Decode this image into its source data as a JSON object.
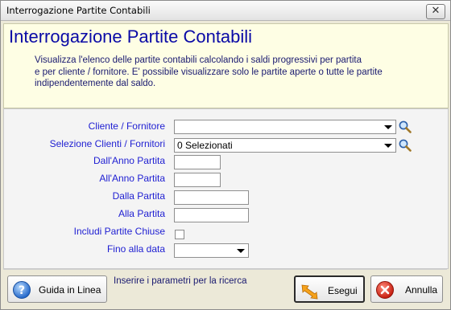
{
  "window": {
    "title": "Interrogazione Partite Contabili",
    "close_glyph": "✕"
  },
  "header": {
    "title": "Interrogazione Partite Contabili",
    "description": [
      "Visualizza l'elenco delle partite contabili calcolando i saldi progressivi per partita",
      "e per cliente / fornitore. E' possibile visualizzare solo le partite aperte o tutte le partite",
      "indipendentemente dal saldo."
    ]
  },
  "form": {
    "cliente_fornitore": {
      "label": "Cliente / Fornitore",
      "value": ""
    },
    "selezione_clienti": {
      "label": "Selezione Clienti / Fornitori",
      "value": "0 Selezionati"
    },
    "dall_anno": {
      "label": "Dall'Anno Partita",
      "value": ""
    },
    "all_anno": {
      "label": "All'Anno Partita",
      "value": ""
    },
    "dalla_partita": {
      "label": "Dalla Partita",
      "value": ""
    },
    "alla_partita": {
      "label": "Alla Partita",
      "value": ""
    },
    "includi_chiuse": {
      "label": "Includi Partite Chiuse",
      "checked": false
    },
    "fino_data": {
      "label": "Fino alla data",
      "value": ""
    }
  },
  "footer": {
    "help_label": "Guida in Linea",
    "status_text": "Inserire i parametri per la ricerca",
    "execute_label": "Esegui",
    "cancel_label": "Annulla"
  },
  "icons": {
    "help": "help-question-icon",
    "execute": "execute-arrow-icon",
    "cancel": "cancel-x-icon",
    "search": "magnifier-icon"
  },
  "colors": {
    "header_bg": "#fefee4",
    "title_blue": "#0a0aa6",
    "label_blue": "#1e1ed2"
  }
}
